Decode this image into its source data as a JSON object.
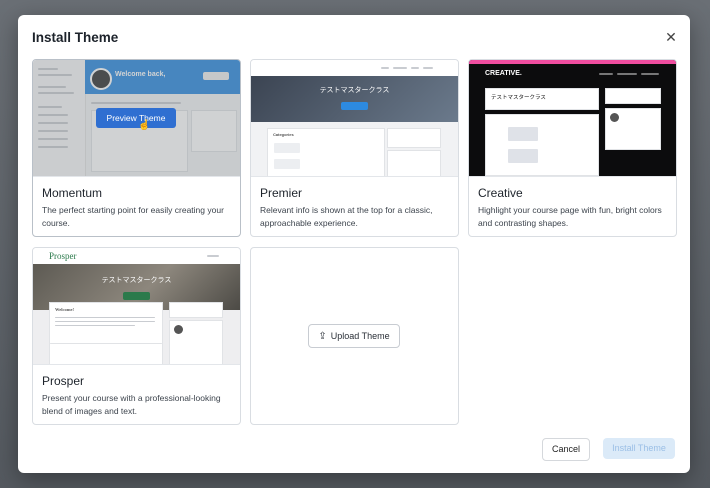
{
  "modal": {
    "title": "Install Theme",
    "close_icon": "close-icon"
  },
  "themes": [
    {
      "name": "Momentum",
      "description": "The perfect starting point for easily creating your course.",
      "preview_label": "Preview Theme",
      "thumb_welcome": "Welcome back,"
    },
    {
      "name": "Premier",
      "description": "Relevant info is shown at the top for a classic, approachable experience.",
      "thumb_title": "テストマスタークラス",
      "thumb_categories": "Categories"
    },
    {
      "name": "Creative",
      "description": "Highlight your course page with fun, bright colors and contrasting shapes.",
      "thumb_logo": "CREATIVE.",
      "thumb_title": "テストマスタークラス"
    },
    {
      "name": "Prosper",
      "description": "Present your course with a professional-looking blend of images and text.",
      "thumb_logo": "Prosper",
      "thumb_title": "テストマスタークラス",
      "thumb_welcome": "Welcome!"
    }
  ],
  "upload": {
    "label": "Upload Theme",
    "icon": "upload-icon"
  },
  "footer": {
    "cancel_label": "Cancel",
    "install_label": "Install Theme"
  },
  "colors": {
    "accent": "#2f6fd1",
    "install_disabled_bg": "#dbeaf8",
    "creative_pink": "#f04ea0",
    "prosper_green": "#2b7a4b"
  }
}
